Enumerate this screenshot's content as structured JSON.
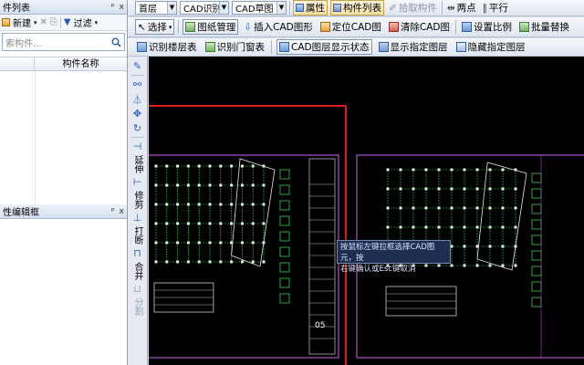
{
  "left_panel_top": {
    "title": "件列表",
    "pin": "ᵖ",
    "close": "x",
    "toolbar": {
      "new_label": "新建",
      "filter_label": "过滤"
    },
    "search_placeholder": "索构件...",
    "column_header": "构件名称"
  },
  "left_panel_bottom": {
    "title": "性编辑框",
    "pin": "ᵖ",
    "close": "x"
  },
  "toolbar_row1": {
    "floor_select": "首层",
    "mode_select": "CAD识别",
    "sheet_select": "CAD草图",
    "properties_label": "属性",
    "component_list_label": "构件列表",
    "pick_component_label": "拾取构件",
    "two_points_label": "两点",
    "parallel_label": "平行"
  },
  "toolbar_row2": {
    "select_label": "选择",
    "drawing_mgmt_label": "图纸管理",
    "insert_cad_label": "插入CAD图形",
    "locate_cad_label": "定位CAD图",
    "clear_cad_label": "清除CAD图",
    "set_scale_label": "设置比例",
    "batch_replace_label": "批量替换"
  },
  "toolbar_row3": {
    "identify_floor_table_label": "识别楼层表",
    "identify_door_window_label": "识别门窗表",
    "layer_display_label": "CAD图层显示状态",
    "show_layer_label": "显示指定图层",
    "hide_layer_label": "隐藏指定图层"
  },
  "side_tools": {
    "extend": "延伸",
    "trim": "修剪",
    "break": "打断",
    "merge": "合并",
    "split": "分割"
  },
  "canvas": {
    "tooltip_line1": "按鼠标左键拉框选择CAD图元，按",
    "tooltip_line2": "右键确认或Esc键取消",
    "sheet_number": "05"
  },
  "colors": {
    "canvas_bg": "#000000",
    "frame_red": "#e01818",
    "frame_magenta": "#b050c8",
    "drawing_green": "#35d04a",
    "drawing_white": "#e8e8e8"
  }
}
